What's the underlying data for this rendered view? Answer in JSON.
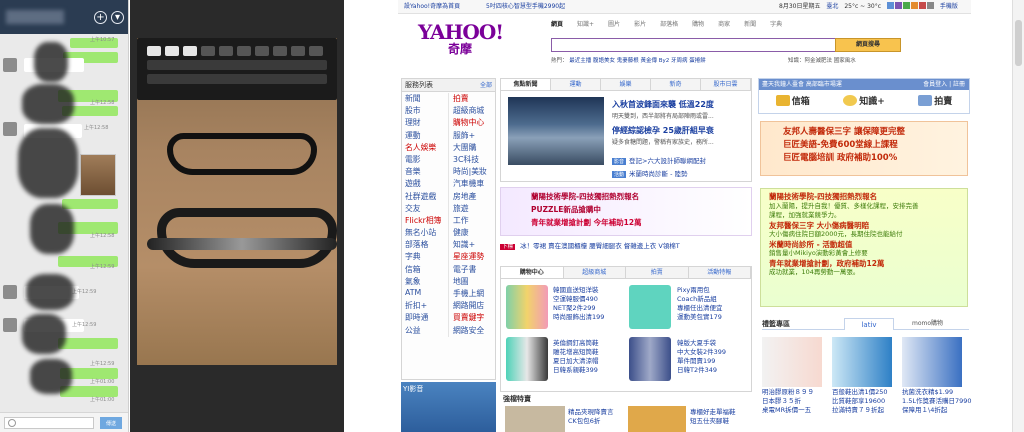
{
  "chat": {
    "messages": [
      {
        "ts": "上午10:57"
      },
      {
        "ts": "上午12:58"
      },
      {
        "ts": "上午12:58"
      },
      {
        "ts": "上午12:58"
      },
      {
        "ts": "上午12:59"
      },
      {
        "ts": "上午12:59"
      },
      {
        "ts": "上午12:59"
      },
      {
        "ts": "上午12:59"
      },
      {
        "ts": "上午01:00"
      },
      {
        "ts": "上午01:00"
      }
    ],
    "send_label": "傳送",
    "icons": [
      "add-icon",
      "chevron-down-icon",
      "smiley-icon"
    ]
  },
  "yahoo": {
    "topbar": {
      "set_home": "設Yahoo!奇摩為首頁",
      "promo": "5吋四核心智慧型手機2990起",
      "date": "8月30日星期五",
      "city": "臺北",
      "temp": "25°c ~ 30°c",
      "mobile": "手機版"
    },
    "logo_text": "YAHOO!",
    "logo_sub": "奇摩",
    "search_tabs": [
      "網頁",
      "知識+",
      "圖片",
      "影片",
      "部落格",
      "購物",
      "商家",
      "新聞",
      "字典"
    ],
    "search_button": "網頁搜尋",
    "hot_label": "熱門：",
    "hot_terms": "最近主播  腹語美女  鬼妻藤根  黃金傳  By2  牙周病  蛋捲餅",
    "hot_terms2": "知識：阿金減肥法  國家風水",
    "services": {
      "title": "服務列表",
      "all": "全部",
      "items": [
        "新聞",
        "拍賣",
        "股市",
        "超級商城",
        "理財",
        "購物中心",
        "運動",
        "服飾+",
        "名人娛樂",
        "大團購",
        "電影",
        "3C科技",
        "音樂",
        "時尚|美妝",
        "遊戲",
        "汽車機車",
        "社群遊戲",
        "房地產",
        "交友",
        "旅遊",
        "Flickr相簿",
        "工作",
        "無名小站",
        "健康",
        "部落格",
        "知識+",
        "字典",
        "星座運勢",
        "信箱",
        "電子書",
        "氣象",
        "地圖",
        "ATM",
        "手機上網",
        "折扣+",
        "網路開店",
        "即時通",
        "買賣鍵字",
        "公益",
        "網路安全"
      ],
      "highlights": [
        "拍賣",
        "購物中心",
        "名人娛樂",
        "Flickr相簿",
        "星座運勢",
        "買賣鍵字"
      ],
      "promo": "YI影音"
    },
    "news": {
      "tabs": [
        "焦點新聞",
        "運動",
        "娛樂",
        "新奇",
        "股市日雲"
      ],
      "headline1": "入秋首波鋒面來襲 低溫22度",
      "sub1": "明天雙到，西半部將有局部陣雨或雷...",
      "headline2": "停經綜認檢孕 25歲肝組早衰",
      "sub2": "疑多食糖問題，警稱有家族史，務所...",
      "link1": "登記>六大設計師聯網配封",
      "link2": "米蘭時尚診斷 - 陸勢",
      "badge1": "影音",
      "badge2": "活動"
    },
    "ad1_line1": "蘭陽技術學院-四技獨招熱烈報名",
    "ad1_line2": "PUZZLE新品搶購中",
    "ad1_line3": "青年就業增搶計劃 今年補助12萬",
    "ticker_tag": "下標",
    "ticker": "冰！零裙  賣在澳國櫃檯  腰臀細腿衣  督雜邊上衣  V領棉T",
    "shop": {
      "tabs": [
        "購物中心",
        "超級商城",
        "拍賣",
        "活動特報"
      ],
      "p1": [
        "韓國直送短洋裝",
        "空運韓服價490",
        "NET聚2件299",
        "時尚服飾出清199"
      ],
      "p2": [
        "Pixy兩用包",
        "Coach新品組",
        "專櫃任出清便宜",
        "運動美包實179"
      ],
      "p3": [
        "英倫鋼釘高筒鞋",
        "雕花增高短筒鞋",
        "夏日加大清涼帽",
        "日韓系親鞋399"
      ],
      "p4": [
        "韓版大夏手袋",
        "中大女裝2件399",
        "單件開賣199",
        "日韓T2件349"
      ]
    },
    "deals_title": "強檔特賣",
    "deal_text": "精品夾現降賣言",
    "deal_text2": "CK包包6折",
    "deal_text3": "專櫃好走單福鞋",
    "deal_text4": "短五仕夾腳鞋",
    "login": {
      "bar": "盡天我鐘人臺會 高部臨市場運",
      "bar_link": "會員登入 | 註冊",
      "btns": [
        "信箱",
        "知識+",
        "拍賣"
      ]
    },
    "promo1": [
      "友邦人壽醫保三字 讓保障更完整",
      "巨匠美語-免費600堂線上課程",
      "巨匠電腦培訓 政府補助100%"
    ],
    "promo2": [
      {
        "t": "蘭陽技術學院-四技獨招熱烈報名",
        "c": "r"
      },
      {
        "t": "加入蘭陽，提升自我！優質、多樣化課程，安排完善",
        "c": "g"
      },
      {
        "t": "課程，加強就業競爭力。",
        "c": "g"
      },
      {
        "t": "友邦醫保三字 大小傷病醫明賠",
        "c": "r"
      },
      {
        "t": "大小傷病住院日額2000元，長期住院也能給付",
        "c": "g"
      },
      {
        "t": "米蘭時尚診所 - 活動超值",
        "c": "r"
      },
      {
        "t": "銷售量小Mikiyo演動彩黃會上修要",
        "c": "g"
      },
      {
        "t": "青年就業增搶計劃，政府補助12萬",
        "c": "r"
      },
      {
        "t": "成功就業，104再勞動一萬張。",
        "c": "g"
      }
    ],
    "gift": {
      "title": "禮籃專區",
      "tab": "lativ",
      "tab2": "momo購物",
      "items": [
        [
          "明治膠原粉８９９",
          "日本膠３５折",
          "桌電MR拆價一五"
        ],
        [
          "百般鞋出清1價250",
          "比質鞋部享19600",
          "拉滿特賣７９折起"
        ],
        [
          "抗菌洗衣精$1.99",
          "1.5L作獎賽活購日7990",
          "保障用１\\4折起"
        ]
      ]
    }
  }
}
